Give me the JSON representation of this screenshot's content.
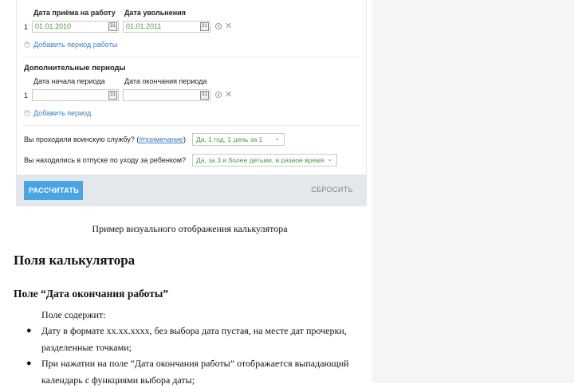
{
  "calculator": {
    "employment": {
      "start_header": "Дата приёма на работу",
      "end_header": "Дата увольнения",
      "rows": [
        {
          "index": "1",
          "start": "01.01.2010",
          "end": "01.01.2011"
        }
      ],
      "add_link": "Добавить период работы"
    },
    "additional": {
      "title": "Дополнительные периоды",
      "start_header": "Дата начала периода",
      "end_header": "Дата окончания периода",
      "rows": [
        {
          "index": "1",
          "start": "",
          "end": ""
        }
      ],
      "add_link": "Добавить период"
    },
    "military": {
      "question_prefix": "Вы проходили воинскую службу? (",
      "note_link": "#примечание",
      "question_suffix": ")",
      "selected": "Да, 1 год, 1 день за 1"
    },
    "parental": {
      "question": "Вы находились в отпуске по уходу за ребенком?",
      "selected": "Да, за 3 и более детьми, в разное время"
    },
    "calendar_icon_text": "31",
    "buttons": {
      "calculate": "РАССЧИТАТЬ",
      "reset": "СБРОСИТЬ"
    },
    "icons": {
      "calendar": "calendar-icon",
      "remove": "close-icon",
      "radio": "radio-icon",
      "add": "plus-circle-icon",
      "dropdown": "chevron-down-icon"
    }
  },
  "document": {
    "caption": "Пример визуального отображения калькулятора",
    "heading": "Поля калькулятора",
    "subheading": "Поле “Дата окончания работы”",
    "intro": "Поле содержит:",
    "bullets": [
      "Дату в формате xx.xx.xxxx, без выбора дата пустая, на месте дат прочерки, разделенные точками;",
      "При нажатии на поле “Дата окончания работы” отображается выпадающий календарь с функциями выбора даты;"
    ]
  }
}
